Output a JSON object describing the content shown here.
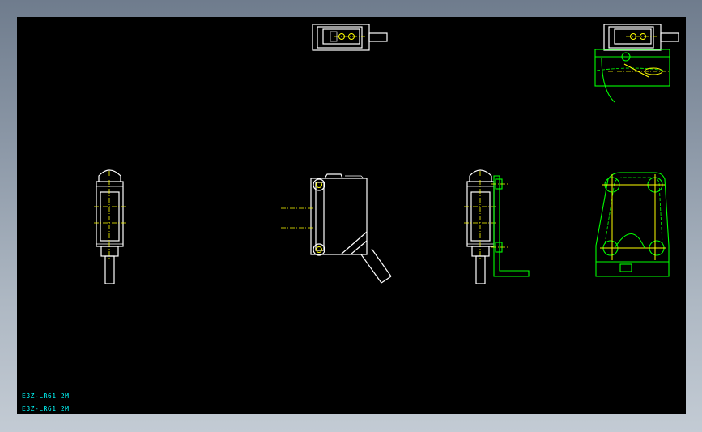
{
  "drawing": {
    "captions": [
      "E3Z-LR61 2M",
      "E3Z-LR61 2M"
    ],
    "colors": {
      "background": "#000000",
      "outline": "#ffffff",
      "center_line": "#ffff00",
      "bracket": "#00ff00",
      "caption": "#00ffff",
      "dimension": "#00c000"
    }
  }
}
